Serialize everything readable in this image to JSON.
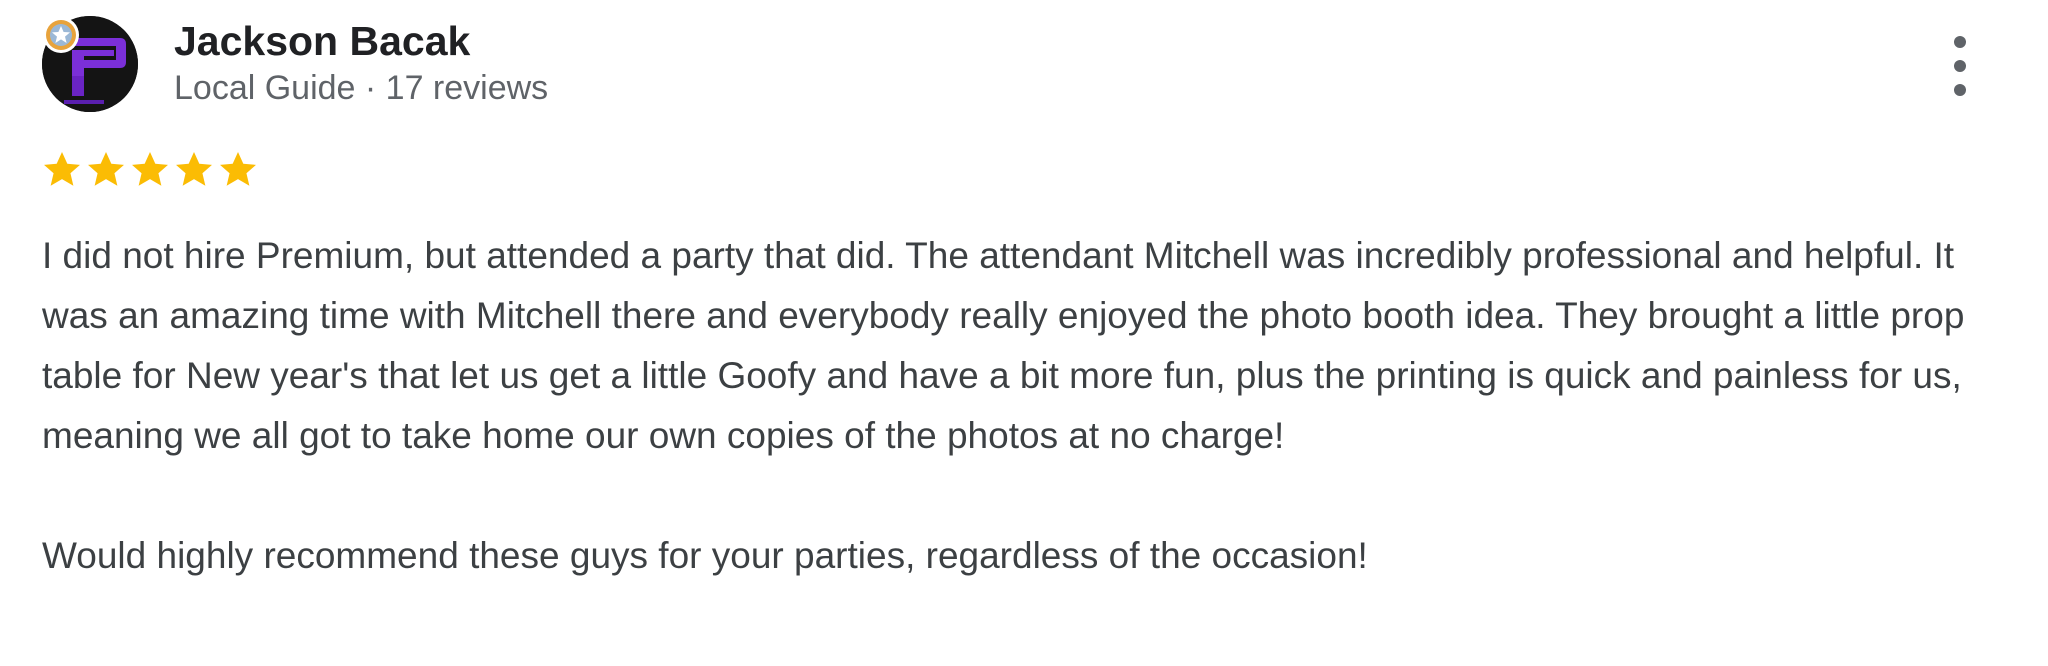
{
  "reviewer": {
    "name": "Jackson Bacak",
    "meta": "Local Guide · 17 reviews",
    "avatar_icon": "purple-letter-p-logo",
    "badge_icon": "local-guide-star-badge"
  },
  "rating": {
    "stars": 5,
    "max": 5,
    "color": "#fbbc04"
  },
  "review": {
    "paragraphs": [
      "I did not hire Premium, but attended a party that did. The attendant Mitchell was incredibly professional and helpful. It was an amazing time with Mitchell there and everybody really enjoyed the photo booth idea. They brought a little prop table for New year's that let us get a little Goofy and have a bit more fun, plus the printing is quick and painless for us, meaning we all got to take home our own copies of the photos at no charge!",
      "Would highly recommend these guys for your parties, regardless of the occasion!"
    ]
  },
  "menu": {
    "icon": "more-vert-icon"
  },
  "colors": {
    "text": "#3c4043",
    "name": "#202124",
    "meta": "#5f6368",
    "avatar_bg": "#141414",
    "avatar_logo": "#7b2fd8"
  }
}
